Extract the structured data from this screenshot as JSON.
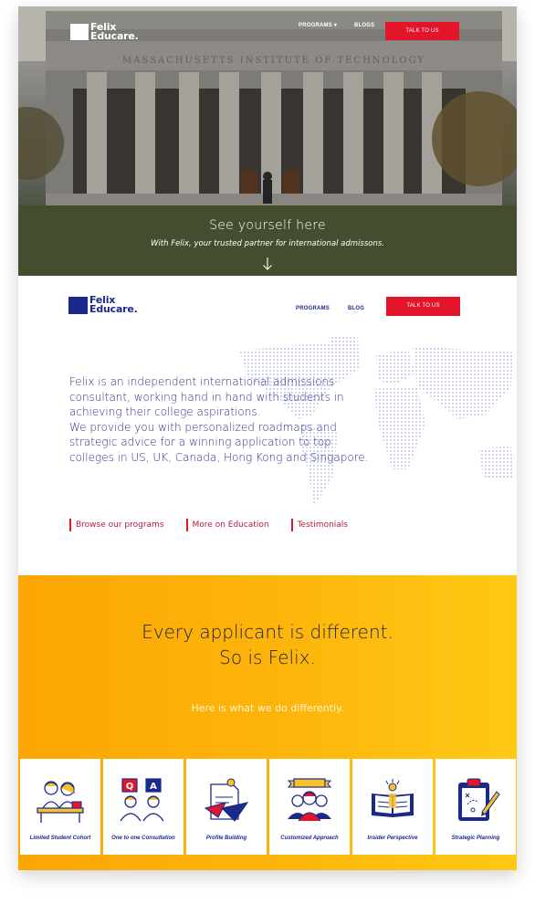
{
  "brand": {
    "logo_line1": "Felix",
    "logo_line2": "Educare.",
    "brand_blue": "#1b2a8a",
    "brand_red": "#e2152b"
  },
  "hero": {
    "nav": {
      "programs": "PROGRAMS",
      "programs_caret": "▾",
      "blogs": "BLOGS",
      "cta": "TALK TO US"
    },
    "building_inscription": "MASSACHUSETTS INSTITUTE OF TECHNOLOGY",
    "title": "See yourself here",
    "subtitle": "With Felix, your trusted partner for international admissons.",
    "scroll_icon": "arrow-down-icon"
  },
  "about": {
    "nav": {
      "programs": "PROGRAMS",
      "blog": "BLOG",
      "cta": "TALK TO US"
    },
    "text_p1": "Felix is an independent international admissions consultant, working hand in hand with students in achieving their college aspirations.",
    "text_p2": "We provide you with personalized roadmaps and strategic advice for a winning application to top colleges in US, UK, Canada, Hong Kong and Singapore.",
    "links": [
      "Browse our programs",
      "More on Education",
      "Testimonials"
    ]
  },
  "different": {
    "title_line1": "Every applicant is different.",
    "title_line2": "So is Felix.",
    "subtitle": "Here is what we do differently.",
    "background": [
      "#fca604",
      "#fec915"
    ],
    "cards": [
      {
        "label": "Limited Student Cohort",
        "icon": "students-desk-icon"
      },
      {
        "label": "One to one Consultation",
        "icon": "qa-consultation-icon"
      },
      {
        "label": "Profile Building",
        "icon": "profile-document-icon"
      },
      {
        "label": "Customized Approach",
        "icon": "group-banner-icon"
      },
      {
        "label": "Insider Perspective",
        "icon": "open-book-icon"
      },
      {
        "label": "Strategic Planning",
        "icon": "clipboard-plan-icon"
      }
    ]
  }
}
